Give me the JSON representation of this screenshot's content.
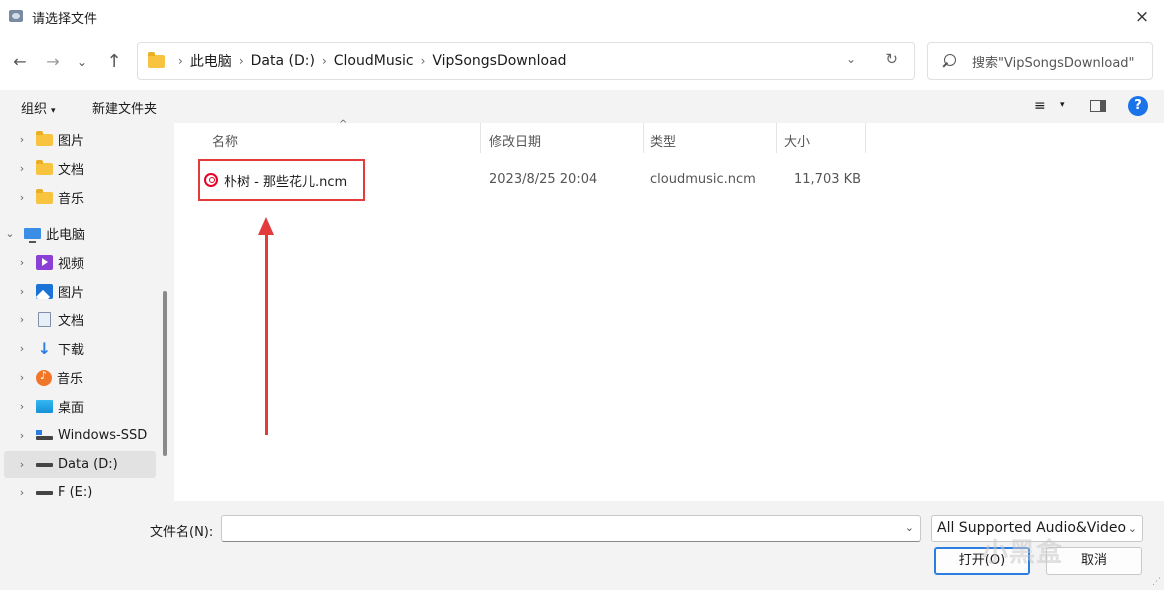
{
  "window": {
    "title": "请选择文件",
    "close": "×"
  },
  "nav": {
    "back": "←",
    "forward": "→",
    "history": "⌄",
    "up": "↑"
  },
  "address": {
    "crumbs": [
      "此电脑",
      "Data (D:)",
      "CloudMusic",
      "VipSongsDownload"
    ],
    "sep": "›",
    "chevron": "⌄",
    "refresh": "↻"
  },
  "search": {
    "placeholder": "搜索\"VipSongsDownload\""
  },
  "commands": {
    "organize": "组织",
    "new_folder": "新建文件夹",
    "caret": "▾",
    "view": "≡"
  },
  "sidebar": {
    "items": [
      {
        "label": "图片",
        "icon": "folder-icon",
        "exp": "›"
      },
      {
        "label": "文档",
        "icon": "folder-icon",
        "exp": "›"
      },
      {
        "label": "音乐",
        "icon": "folder-icon",
        "exp": "›"
      },
      {
        "label": "此电脑",
        "icon": "pc-icon",
        "exp": "⌄"
      },
      {
        "label": "视频",
        "icon": "video-icon",
        "exp": "›"
      },
      {
        "label": "图片",
        "icon": "pictures-icon",
        "exp": "›"
      },
      {
        "label": "文档",
        "icon": "document-icon",
        "exp": "›"
      },
      {
        "label": "下载",
        "icon": "download-icon",
        "exp": "›"
      },
      {
        "label": "音乐",
        "icon": "music-icon",
        "exp": "›"
      },
      {
        "label": "桌面",
        "icon": "desktop-icon",
        "exp": "›"
      },
      {
        "label": "Windows-SSD",
        "icon": "ssd-drive-icon",
        "exp": "›"
      },
      {
        "label": "Data (D:)",
        "icon": "drive-icon",
        "exp": "›"
      },
      {
        "label": "F (E:)",
        "icon": "drive-icon",
        "exp": "›"
      }
    ]
  },
  "columns": {
    "name": "名称",
    "modified": "修改日期",
    "type": "类型",
    "size": "大小",
    "sort_caret": "^"
  },
  "files": [
    {
      "name": "朴树 - 那些花儿.ncm",
      "modified": "2023/8/25 20:04",
      "type": "cloudmusic.ncm",
      "size": "11,703 KB"
    }
  ],
  "bottom": {
    "filename_label": "文件名(N):",
    "filename_value": "",
    "filter": "All Supported Audio&Video",
    "open": "打开(O)",
    "cancel": "取消",
    "watermark": "小黑盒"
  },
  "colors": {
    "accent": "#2a7de1",
    "highlight": "#e33b3b",
    "help": "#1a73e8"
  }
}
